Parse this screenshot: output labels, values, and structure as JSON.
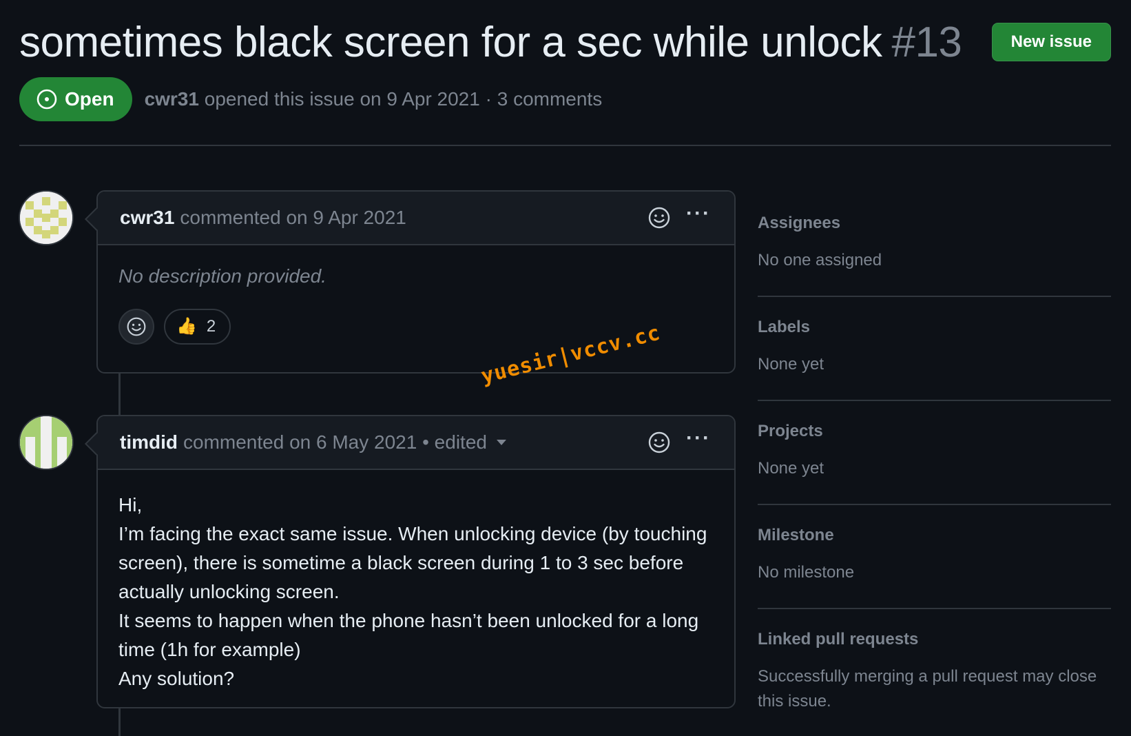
{
  "issue": {
    "title": "sometimes black screen for a sec while unlock",
    "number": "#13",
    "state": "Open",
    "author": "cwr31",
    "opened_text": "opened this issue on 9 Apr 2021 · 3 comments"
  },
  "toolbar": {
    "new_issue_label": "New issue"
  },
  "comments": [
    {
      "author": "cwr31",
      "meta": "commented on 9 Apr 2021",
      "body_placeholder": "No description provided.",
      "reaction": {
        "emoji": "👍",
        "count": "2"
      }
    },
    {
      "author": "timdid",
      "meta": "commented on 6 May 2021 • edited",
      "body_lines": [
        "Hi,",
        "I’m facing the exact same issue. When unlocking device (by touching screen), there is sometime a black screen during 1 to 3 sec before actually unlocking screen.",
        "It seems to happen when the phone hasn’t been unlocked for a long time (1h for example)",
        "Any solution?"
      ]
    }
  ],
  "sidebar": {
    "assignees": {
      "label": "Assignees",
      "value": "No one assigned"
    },
    "labels": {
      "label": "Labels",
      "value": "None yet"
    },
    "projects": {
      "label": "Projects",
      "value": "None yet"
    },
    "milestone": {
      "label": "Milestone",
      "value": "No milestone"
    },
    "linked_prs": {
      "label": "Linked pull requests",
      "value": "Successfully merging a pull request may close this issue."
    }
  },
  "watermark": "yuesir|vccv.cc",
  "colors": {
    "background": "#0d1117",
    "accent_green": "#238636",
    "border": "#30363d",
    "muted_text": "#7d8590"
  }
}
